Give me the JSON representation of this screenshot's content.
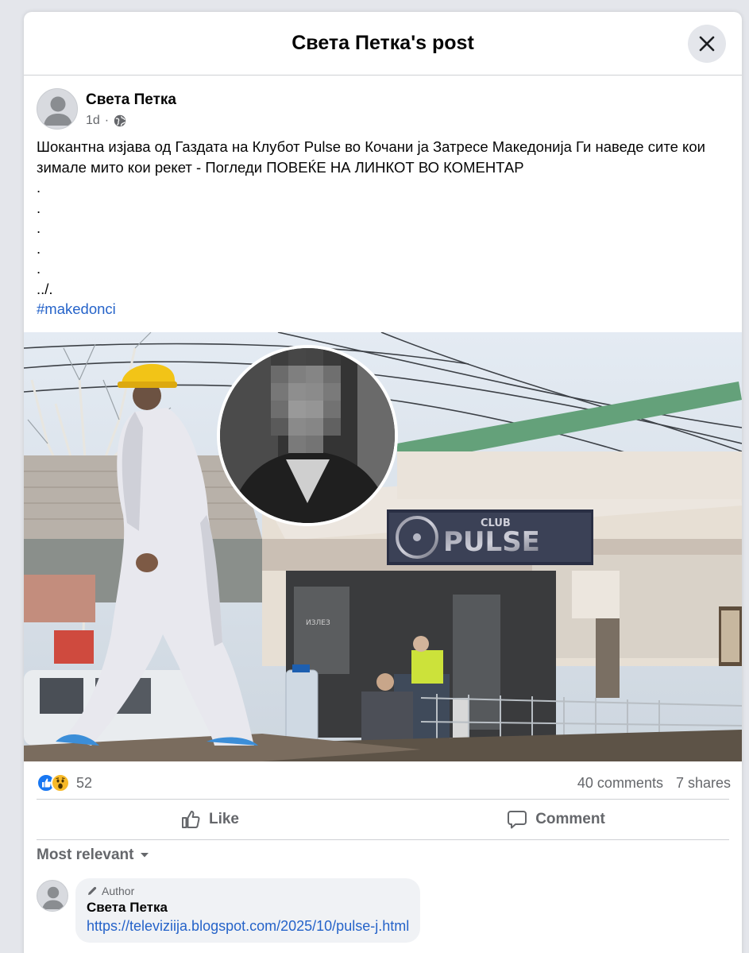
{
  "modal": {
    "title": "Света Петка's post",
    "close_icon": "close-icon"
  },
  "post": {
    "author": "Света Петка",
    "time": "1d",
    "separator": "·",
    "audience_icon": "globe-icon",
    "text_main": "Шокантна изјава од Газдата на Клубот Pulse во Кочани ја Затресе Македонија Ги наведе сите кои зимале мито кои рекет - Погледи ПОВЕЌЕ НА ЛИНКОТ ВО КОМЕНТАР",
    "dots": [
      ".",
      ".",
      ".",
      ".",
      "."
    ],
    "trail": "../.",
    "hashtag": "#makedonci",
    "image_sign_text": "CLUB PULSE",
    "image_door_text": "ИЗЛЕЗ"
  },
  "reactions": {
    "count": "52",
    "icons": [
      "like-reaction-icon",
      "wow-reaction-icon"
    ],
    "comments": "40 comments",
    "shares": "7 shares"
  },
  "actions": {
    "like": "Like",
    "comment": "Comment"
  },
  "sort": {
    "label": "Most relevant"
  },
  "comments": [
    {
      "badge": "Author",
      "author": "Света Петка",
      "link": "https://televiziija.blogspot.com/2025/10/pulse-j.html"
    }
  ],
  "colors": {
    "link": "#2563c9",
    "like_blue": "#1877f2",
    "wow_yellow": "#f7b928",
    "text_secondary": "#65676b"
  }
}
